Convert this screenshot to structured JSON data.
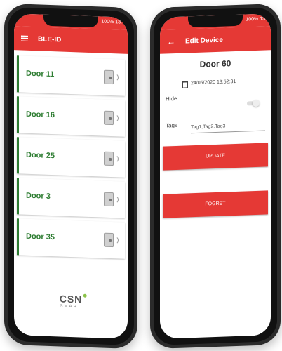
{
  "left_phone": {
    "status": "100% 13:",
    "title": "BLE-ID",
    "doors": [
      {
        "label": "Door 11"
      },
      {
        "label": "Door 16"
      },
      {
        "label": "Door 25"
      },
      {
        "label": "Door 3"
      },
      {
        "label": "Door 35"
      }
    ],
    "logo": {
      "main": "CSN",
      "sub": "SMART"
    }
  },
  "right_phone": {
    "status": "100% 13",
    "title": "Edit Device",
    "device_name": "Door 60",
    "hide_label": "Hide",
    "date": "24/05/2020 13:52:31",
    "tags_label": "Tags",
    "tags_value": "Tag1,Tag2,Tag3",
    "update_label": "UPDATE",
    "forget_label": "FOGRET"
  },
  "colors": {
    "accent": "#e53935",
    "door_green": "#2e7d32"
  },
  "icons": [
    "menu-icon",
    "lock-icon",
    "back-icon",
    "calendar-icon",
    "toggle-switch"
  ]
}
